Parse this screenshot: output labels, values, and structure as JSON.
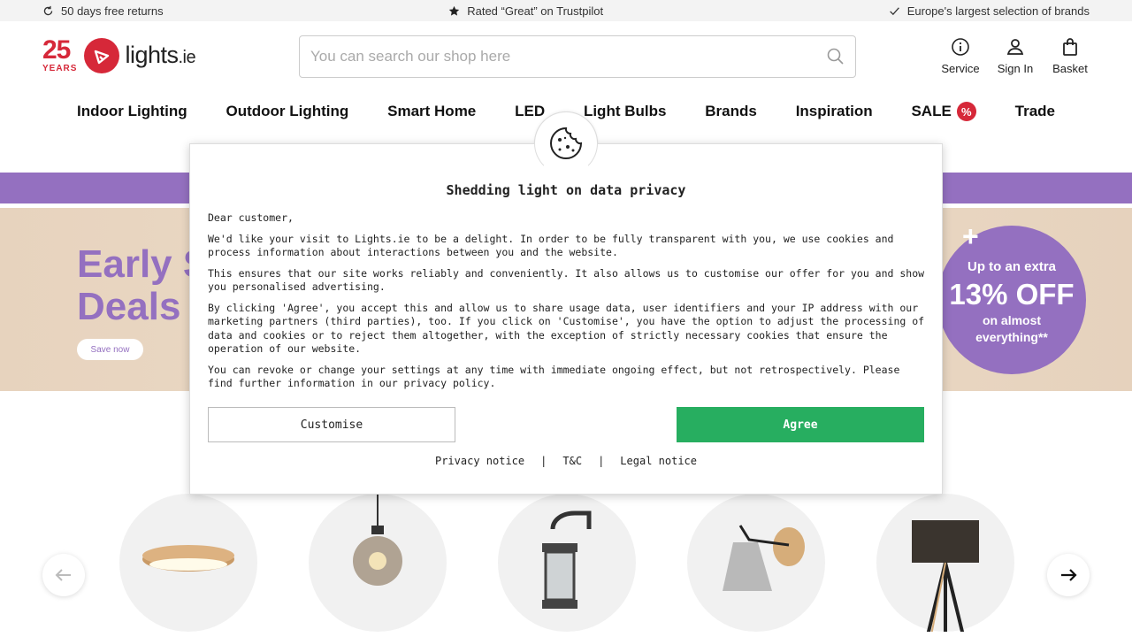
{
  "topbar": {
    "returns": "50 days free returns",
    "rating": "Rated “Great” on Trustpilot",
    "selection": "Europe's largest selection of brands"
  },
  "logo": {
    "years_num": "25",
    "years_label": "YEARS",
    "word": "lights",
    "tld": ".ie"
  },
  "search": {
    "placeholder": "You can search our shop here"
  },
  "header_actions": {
    "service": "Service",
    "signin": "Sign In",
    "basket": "Basket"
  },
  "nav": {
    "items": [
      "Indoor Lighting",
      "Outdoor Lighting",
      "Smart Home",
      "LED",
      "Light Bulbs",
      "Brands",
      "Inspiration",
      "SALE",
      "Trade"
    ],
    "sale_icon": "%"
  },
  "hero": {
    "title_line1": "Early S",
    "title_line2": "Deals",
    "button": "Save now",
    "badge_plus": "+",
    "badge_l1": "Up to an extra",
    "badge_l2": "13% OFF",
    "badge_l3": "on almost",
    "badge_l4": "everything**"
  },
  "modal": {
    "title": "Shedding light on data privacy",
    "p1": "Dear customer,",
    "p2": "We'd like your visit to Lights.ie to be a delight. In order to be fully transparent with you, we use cookies and process information about interactions between you and the website.",
    "p3": "This ensures that our site works reliably and conveniently. It also allows us to customise our offer for you and show you personalised advertising.",
    "p4": "By clicking 'Agree', you accept this and allow us to share usage data, user identifiers and your IP address with our marketing partners (third parties), too. If you click on 'Customise', you have the option to adjust the processing of data and cookies or to reject them altogether, with the exception of strictly necessary cookies that ensure the operation of our website.",
    "p5": "You can revoke or change your settings at any time with immediate ongoing effect, but not retrospectively. Please find further information in our privacy policy.",
    "customise": "Customise",
    "agree": "Agree",
    "link_privacy": "Privacy notice",
    "link_sep": "|",
    "link_tc": "T&C",
    "link_legal": "Legal notice"
  },
  "colors": {
    "brand_red": "#d62839",
    "purple": "#9470c0",
    "agree_green": "#27ae60"
  }
}
